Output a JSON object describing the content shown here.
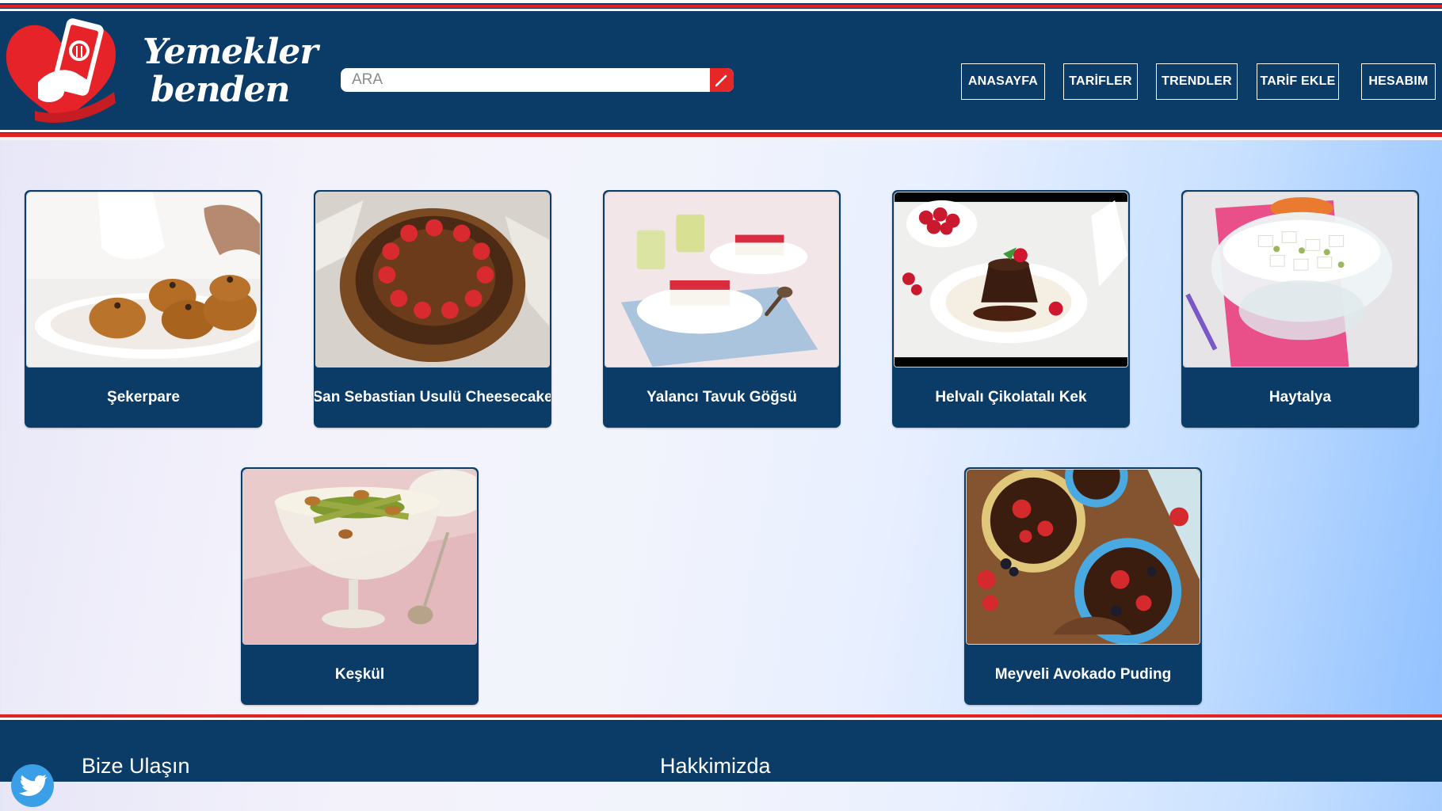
{
  "brand": {
    "line1": "Yemekler",
    "line2": "benden"
  },
  "search": {
    "placeholder": "ARA"
  },
  "nav": [
    {
      "label": "ANASAYFA"
    },
    {
      "label": "TARİFLER"
    },
    {
      "label": "TRENDLER"
    },
    {
      "label": "TARİF EKLE"
    },
    {
      "label": "HESABIM"
    }
  ],
  "recipes": [
    {
      "title": "Şekerpare"
    },
    {
      "title": "San Sebastian Usulü Cheesecake"
    },
    {
      "title": "Yalancı Tavuk Göğsü"
    },
    {
      "title": "Helvalı Çikolatalı Kek"
    },
    {
      "title": "Haytalya"
    },
    {
      "title": "Keşkül"
    },
    {
      "title": "Meyveli Avokado Puding"
    }
  ],
  "footer": {
    "contact_heading": "Bize Ulaşın",
    "about_heading": "Hakkimizda"
  },
  "colors": {
    "primary": "#0b3c68",
    "accent": "#e32222"
  }
}
